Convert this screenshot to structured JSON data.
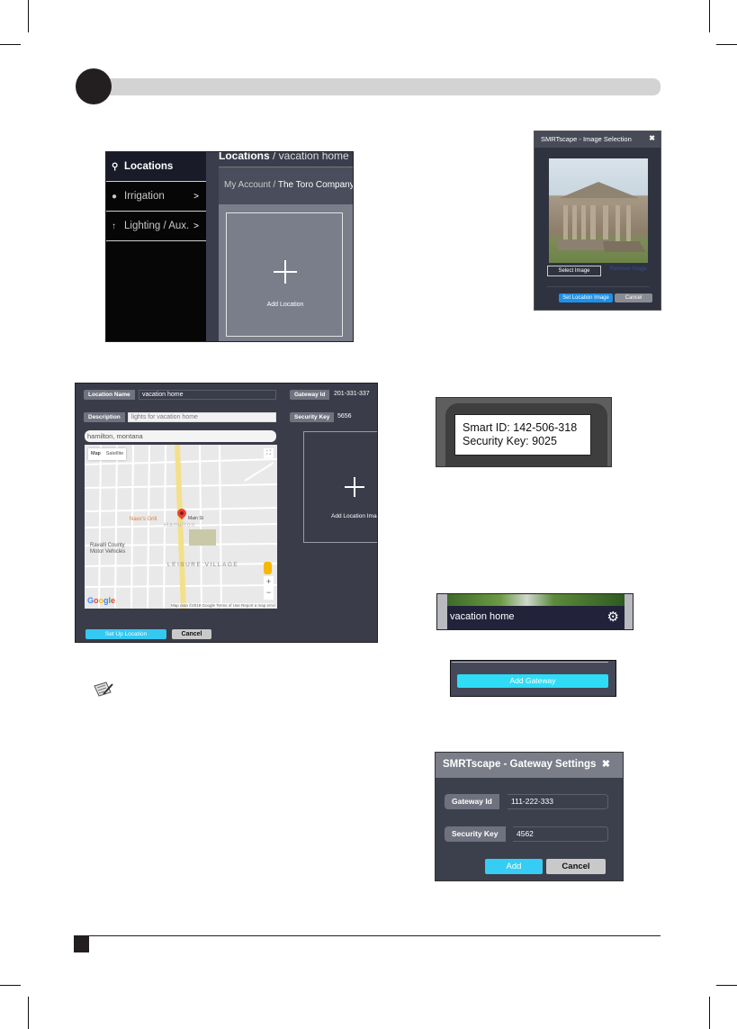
{
  "page": {
    "step_marker": "",
    "note_icon": "note-pencil-icon"
  },
  "sidebar_panel": {
    "sidebar": [
      {
        "label": "Locations",
        "icon": "map-pin-icon",
        "active": true
      },
      {
        "label": "Irrigation",
        "icon": "water-drop-icon",
        "chevron": ">"
      },
      {
        "label": "Lighting / Aux.",
        "icon": "arrow-up-icon",
        "chevron": ">"
      }
    ],
    "title_bold": "Locations",
    "title_rest": " / vacation home",
    "crumb_prefix": "My Account / ",
    "crumb_company": "The Toro Company",
    "add_location_label": "Add Location"
  },
  "image_dialog": {
    "title": "SMRTscape - Image Selection",
    "close": "✖",
    "select_image": "Select Image",
    "remove_image": "Remove Image",
    "set_location_image": "Set Location Image",
    "cancel": "Cancel"
  },
  "location_form": {
    "location_name_label": "Location Name",
    "location_name_value": "vacation home",
    "description_label": "Description",
    "description_value": "lights for vacation home",
    "address_value": "hamilton, montana",
    "gateway_id_label": "Gateway Id",
    "gateway_id_value": "201-331-337",
    "security_key_label": "Security Key",
    "security_key_value": "5656",
    "add_location_image": "Add Location Image",
    "set_up_location": "Set Up Location",
    "cancel": "Cancel",
    "map": {
      "tab_map": "Map",
      "tab_satellite": "Satellite",
      "poi_restaurant": "Naxx's Grill",
      "poi_dmv_line1": "Ravalli County",
      "poi_dmv_line2": "Motor Vehicles",
      "town": "Hamilton",
      "district": "LEISURE VILLAGE",
      "street_main": "Main St",
      "zoom_in": "+",
      "zoom_out": "−",
      "attribution": "Map data ©2018 Google   Terms of Use   Report a map error",
      "logo": [
        "G",
        "o",
        "o",
        "g",
        "l",
        "e"
      ]
    }
  },
  "device_label": {
    "line1": "Smart ID: 142-506-318",
    "line2": "Security Key: 9025"
  },
  "location_tile": {
    "title": "vacation home",
    "gear": "⚙"
  },
  "add_gateway": {
    "button": "Add Gateway"
  },
  "gateway_dialog": {
    "title": "SMRTscape - Gateway Settings",
    "close": "✖",
    "gateway_id_label": "Gateway Id",
    "gateway_id_value": "111-222-333",
    "security_key_label": "Security Key",
    "security_key_value": "4562",
    "add": "Add",
    "cancel": "Cancel"
  }
}
